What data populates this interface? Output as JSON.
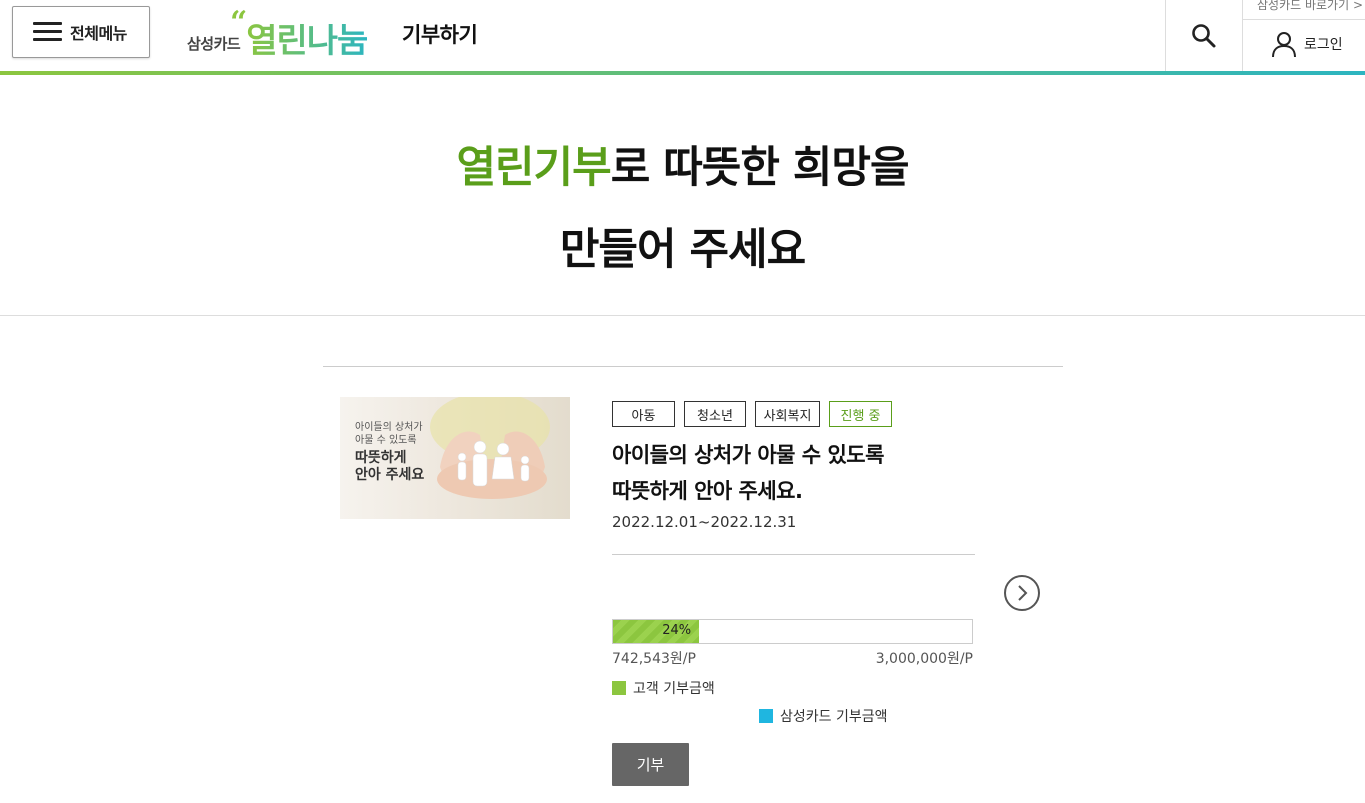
{
  "header": {
    "menu_label": "전체메뉴",
    "logo_small": "삼성카드",
    "logo_big": "열린나눔",
    "logo_quote": "“",
    "page_title": "기부하기",
    "shortcut_label": "삼성카드 바로가기 >",
    "login_label": "로그인",
    "accent_colors": [
      "#8cc63f",
      "#2cb5c0"
    ]
  },
  "hero": {
    "highlight": "열린기부",
    "line1_rest": "로 따뜻한 희망을",
    "line2": "만들어 주세요",
    "highlight_color": "#5a9e1a"
  },
  "campaign": {
    "thumb_line1": "아이들의 상처가",
    "thumb_line2": "아물 수 있도록",
    "thumb_line3": "따뜻하게",
    "thumb_line4": "안아 주세요",
    "tags": [
      "아동",
      "청소년",
      "사회복지"
    ],
    "status": "진행 중",
    "title_line1": "아이들의 상처가 아물 수 있도록",
    "title_line2": "따뜻하게 안아 주세요.",
    "period": "2022.12.01~2022.12.31",
    "progress_percent": 24,
    "progress_label": "24%",
    "current_amount": "742,543원/P",
    "goal_amount": "3,000,000원/P",
    "legend": [
      {
        "label": "고객 기부금액",
        "color": "#8cc63f"
      },
      {
        "label": "삼성카드 기부금액",
        "color": "#1fb6e0"
      }
    ],
    "donate_label": "기부",
    "next_icon": "chevron-right-circle-icon"
  }
}
